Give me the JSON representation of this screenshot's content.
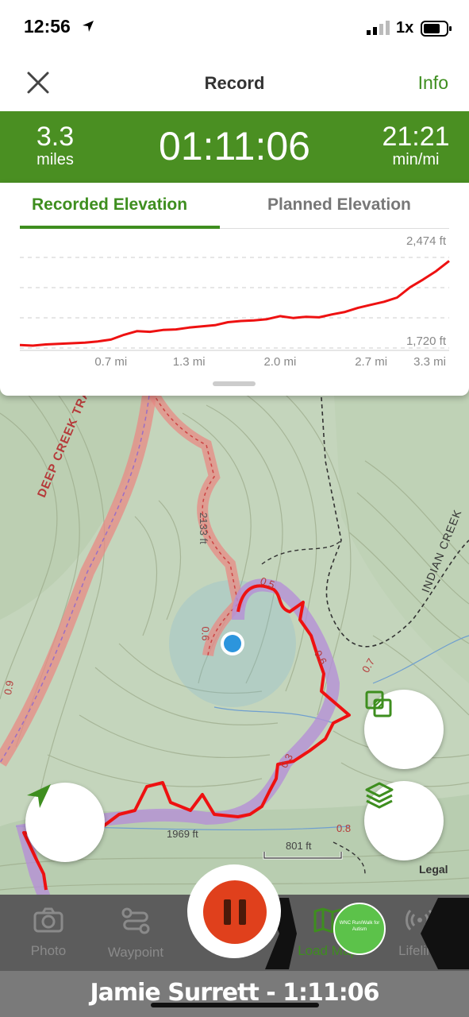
{
  "status_bar": {
    "time": "12:56",
    "zoom": "1x"
  },
  "header": {
    "title": "Record",
    "info_label": "Info"
  },
  "stats": {
    "distance_value": "3.3",
    "distance_unit": "miles",
    "elapsed": "01:11:06",
    "pace_value": "21:21",
    "pace_unit": "min/mi"
  },
  "tabs": {
    "recorded": "Recorded Elevation",
    "planned": "Planned Elevation"
  },
  "chart_data": {
    "type": "line",
    "title": "",
    "xlabel": "",
    "ylabel": "",
    "x_ticks": [
      "0.7 mi",
      "1.3 mi",
      "2.0 mi",
      "2.7 mi",
      "3.3 mi"
    ],
    "y_max_label": "2,474 ft",
    "y_min_label": "1,720 ft",
    "ylim": [
      1720,
      2474
    ],
    "xlim": [
      0,
      3.3
    ],
    "grid": true,
    "series": [
      {
        "color": "#ee1111",
        "x": [
          0,
          0.1,
          0.2,
          0.3,
          0.4,
          0.5,
          0.6,
          0.7,
          0.8,
          0.9,
          1.0,
          1.1,
          1.2,
          1.3,
          1.4,
          1.5,
          1.6,
          1.7,
          1.8,
          1.9,
          2.0,
          2.1,
          2.2,
          2.3,
          2.4,
          2.5,
          2.6,
          2.7,
          2.8,
          2.9,
          3.0,
          3.1,
          3.2,
          3.3
        ],
        "y": [
          1745,
          1740,
          1750,
          1755,
          1760,
          1765,
          1775,
          1790,
          1830,
          1860,
          1855,
          1870,
          1875,
          1890,
          1900,
          1910,
          1935,
          1945,
          1950,
          1960,
          1985,
          1970,
          1980,
          1975,
          2000,
          2020,
          2055,
          2080,
          2105,
          2140,
          2225,
          2290,
          2360,
          2445
        ]
      }
    ]
  },
  "map": {
    "labels": {
      "trail": "DEEP CREEK TRAIL",
      "creek": "INDIAN CREEK",
      "elev1": "2133 ft",
      "elev2": "1969 ft"
    },
    "mile_markers": [
      "0.5",
      "0.6",
      "0.7",
      "0.3",
      "0.9",
      "0.8",
      "0.6"
    ],
    "scale": "801 ft",
    "legal": "Legal"
  },
  "toolbar": {
    "photo": "Photo",
    "waypoint": "Waypoint",
    "load_map": "Load Map",
    "lifeline": "Lifeline"
  },
  "badge_text": "WNC Run/Walk for Autism",
  "caption": "Jamie Surrett - 1:11:06",
  "colors": {
    "accent": "#4a8f22",
    "track": "#ee1111",
    "record": "#e0401c"
  }
}
